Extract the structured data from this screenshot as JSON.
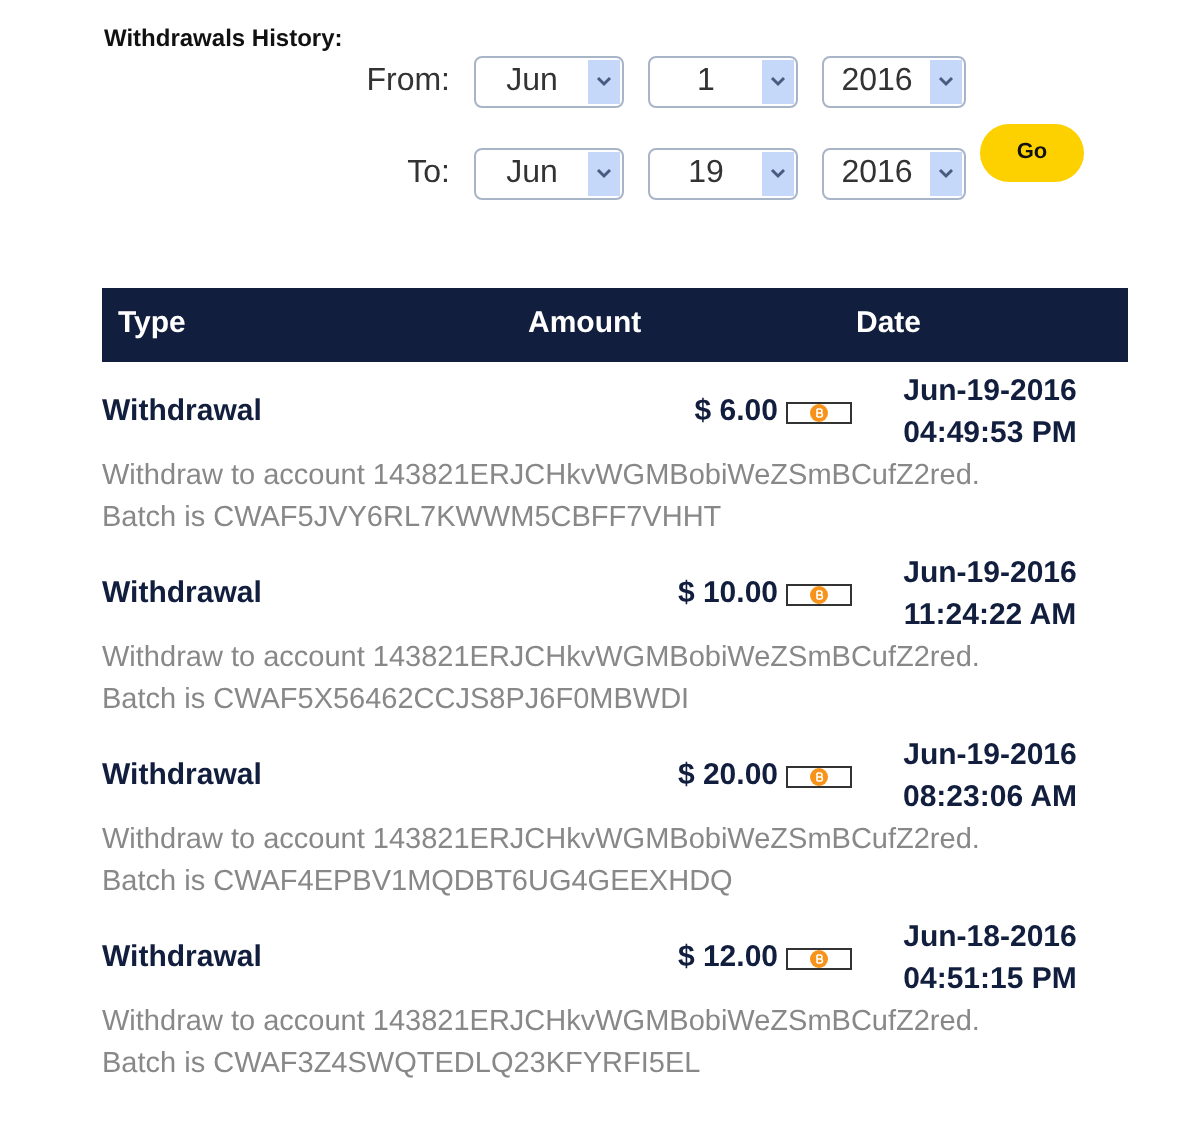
{
  "title": "Withdrawals History:",
  "filters": [
    {
      "label": "From:",
      "month": "Jun",
      "day": "1",
      "year": "2016"
    },
    {
      "label": "To:",
      "month": "Jun",
      "day": "19",
      "year": "2016"
    }
  ],
  "go_button": "Go",
  "table": {
    "columns": [
      "Type",
      "Amount",
      "Date"
    ],
    "rows": [
      {
        "type": "Withdrawal",
        "amount": "$ 6.00",
        "date": "Jun-19-2016",
        "time": "04:49:53 PM",
        "description": "Withdraw to account 143821ERJCHkvWGMBobiWeZSmBCufZ2red.",
        "batch": "Batch is CWAF5JVY6RL7KWWM5CBFF7VHHT"
      },
      {
        "type": "Withdrawal",
        "amount": "$ 10.00",
        "date": "Jun-19-2016",
        "time": "11:24:22 AM",
        "description": "Withdraw to account 143821ERJCHkvWGMBobiWeZSmBCufZ2red.",
        "batch": "Batch is CWAF5X56462CCJS8PJ6F0MBWDI"
      },
      {
        "type": "Withdrawal",
        "amount": "$ 20.00",
        "date": "Jun-19-2016",
        "time": "08:23:06 AM",
        "description": "Withdraw to account 143821ERJCHkvWGMBobiWeZSmBCufZ2red.",
        "batch": "Batch is CWAF4EPBV1MQDBT6UG4GEEXHDQ"
      },
      {
        "type": "Withdrawal",
        "amount": "$ 12.00",
        "date": "Jun-18-2016",
        "time": "04:51:15 PM",
        "description": "Withdraw to account 143821ERJCHkvWGMBobiWeZSmBCufZ2red.",
        "batch": "Batch is CWAF3Z4SWQTEDLQ23KFYRFI5EL"
      }
    ]
  }
}
